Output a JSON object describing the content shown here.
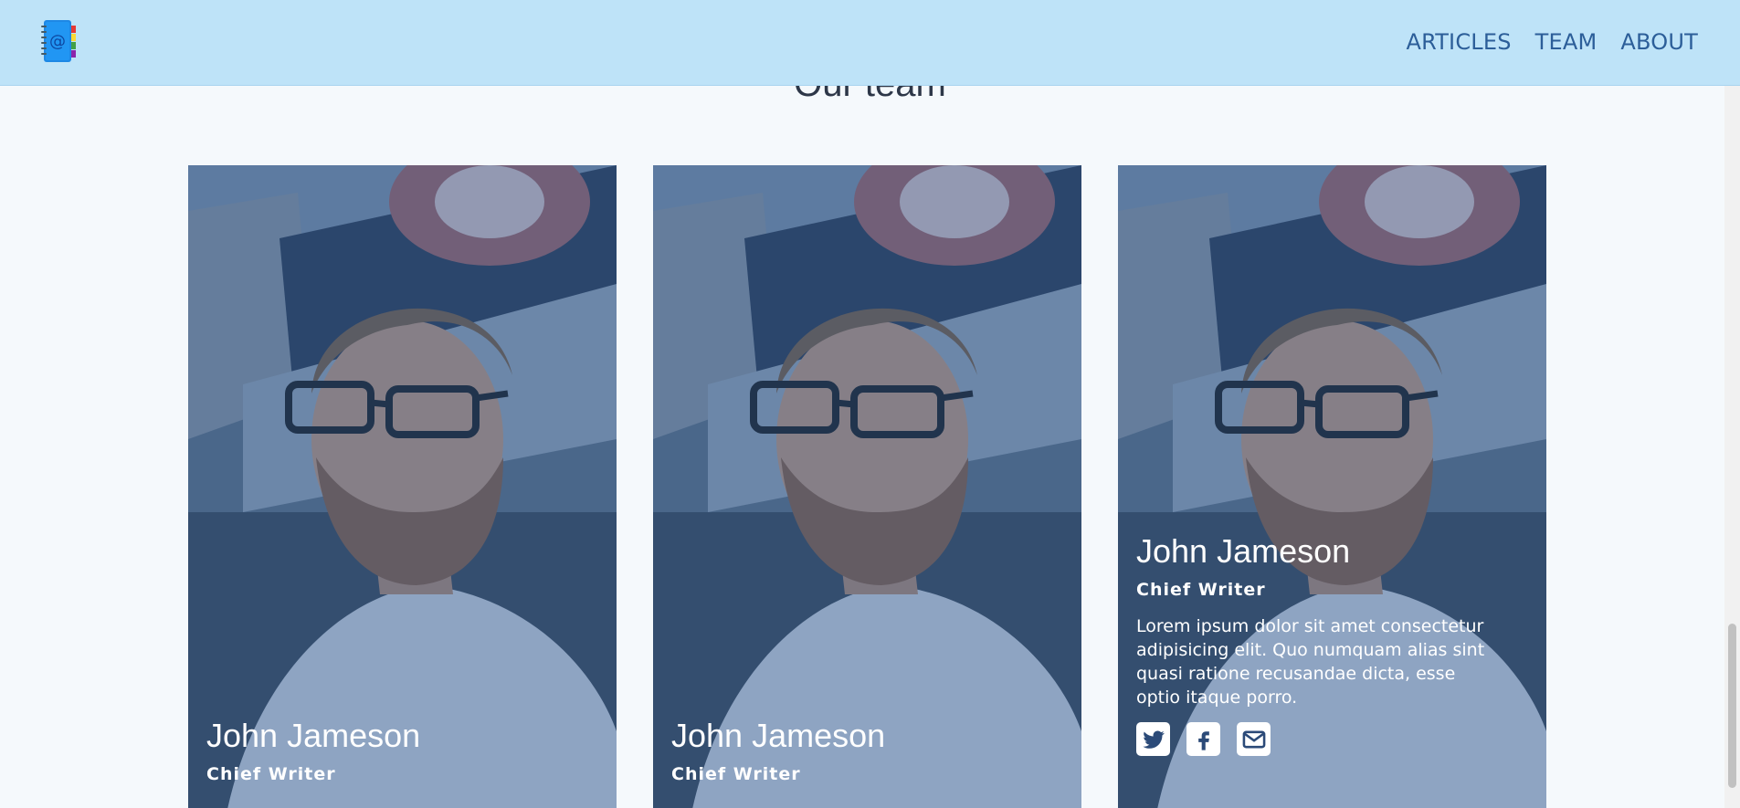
{
  "header": {
    "logo": "address-book-logo",
    "nav": [
      {
        "label": "ARTICLES"
      },
      {
        "label": "TEAM"
      },
      {
        "label": "ABOUT"
      }
    ]
  },
  "team": {
    "title": "Our team",
    "members": [
      {
        "name": "John Jameson",
        "role": "Chief Writer"
      },
      {
        "name": "John Jameson",
        "role": "Chief Writer"
      },
      {
        "name": "John Jameson",
        "role": "Chief Writer",
        "bio": "Lorem ipsum dolor sit amet consectetur adipisicing elit. Quo numquam alias sint quasi ratione recusandae dicta, esse optio itaque porro.",
        "socials": [
          "twitter-icon",
          "facebook-icon",
          "mail-icon"
        ]
      }
    ]
  },
  "colors": {
    "header_bg": "#bee3f8",
    "nav_text": "#2c5e99",
    "overlay": "#366096",
    "page_bg": "#f5f9fc"
  }
}
